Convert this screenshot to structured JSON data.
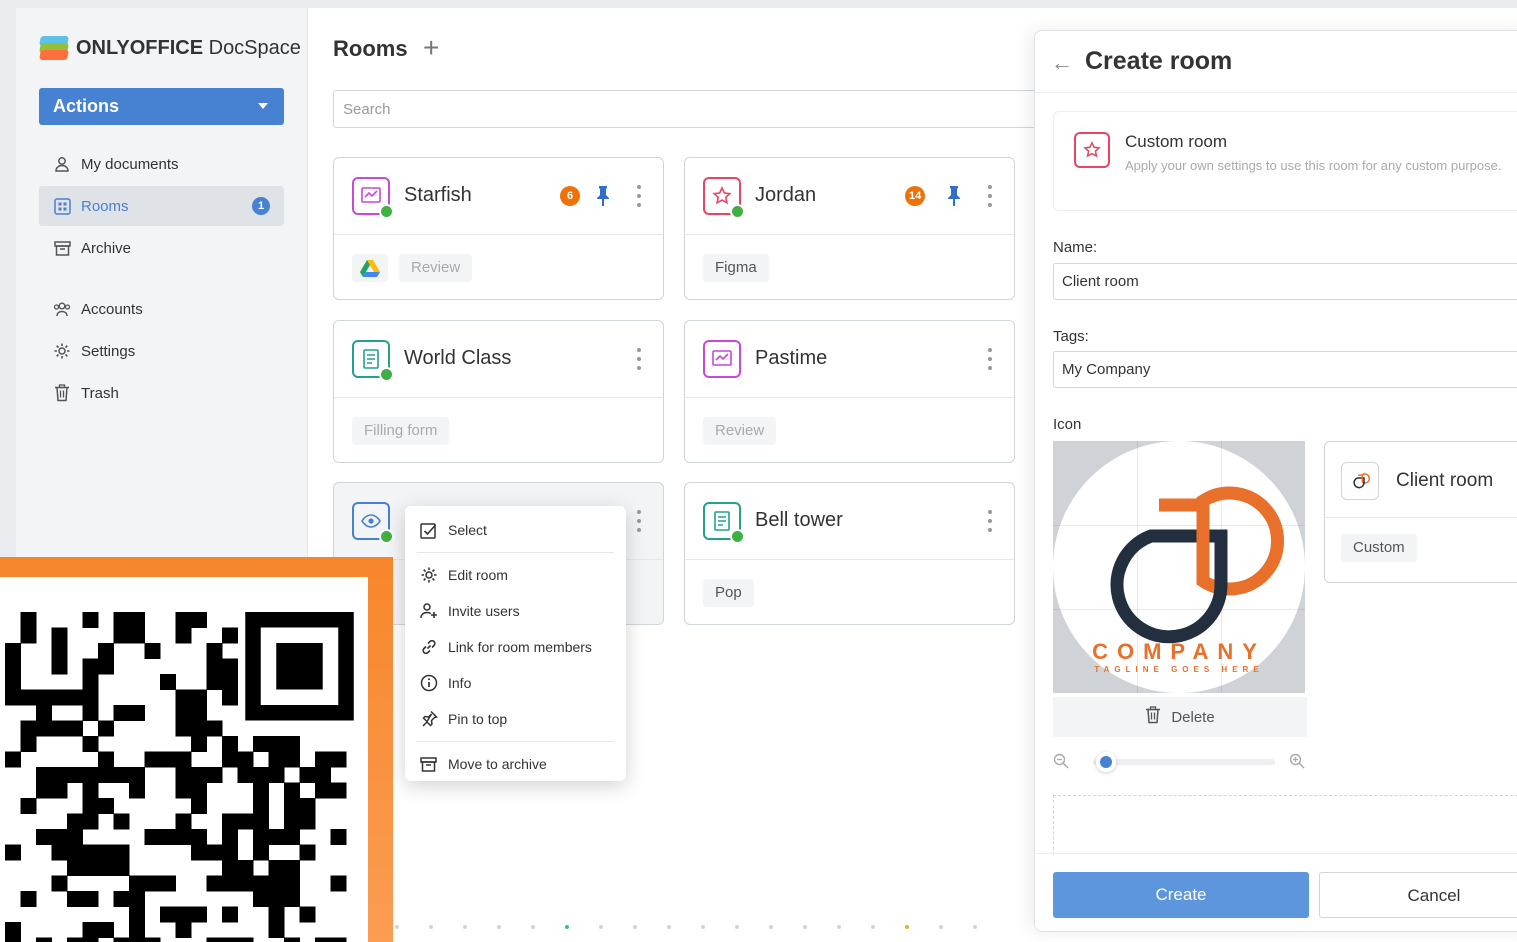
{
  "app": {
    "brand_bold": "ONLYOFFICE",
    "brand_light": " DocSpace"
  },
  "sidebar": {
    "actions_label": "Actions",
    "items": [
      {
        "label": "My documents",
        "icon": "user-icon"
      },
      {
        "label": "Rooms",
        "icon": "rooms-icon",
        "badge": "1",
        "active": true
      },
      {
        "label": "Archive",
        "icon": "archive-icon"
      },
      {
        "label": "Accounts",
        "icon": "accounts-icon"
      },
      {
        "label": "Settings",
        "icon": "gear-icon"
      },
      {
        "label": "Trash",
        "icon": "trash-icon"
      }
    ]
  },
  "main": {
    "title": "Rooms",
    "add_label": "+",
    "search_placeholder": "Search"
  },
  "rooms": [
    {
      "name": "Starfish",
      "tag": "Review",
      "count": "6",
      "pinned": true,
      "color": "#c649d8"
    },
    {
      "name": "Jordan",
      "tag": "Figma",
      "count": "14",
      "pinned": true,
      "color": "#e64564"
    },
    {
      "name": "World Class",
      "tag": "Filling form",
      "color": "#22a090"
    },
    {
      "name": "Pastime",
      "tag": "Review",
      "color": "#c649d8"
    },
    {
      "name": "",
      "tag": "",
      "color": "#4781d1"
    },
    {
      "name": "Bell tower",
      "tag": "Pop",
      "color": "#22a090"
    }
  ],
  "context_menu": {
    "items": [
      {
        "label": "Select",
        "icon": "select-icon"
      },
      {
        "label": "Edit room",
        "icon": "gear-icon"
      },
      {
        "label": "Invite users",
        "icon": "invite-user-icon"
      },
      {
        "label": "Link for room members",
        "icon": "link-icon"
      },
      {
        "label": "Info",
        "icon": "info-icon"
      },
      {
        "label": "Pin to top",
        "icon": "pin-icon"
      },
      {
        "label": "Move to archive",
        "icon": "archive-icon"
      }
    ]
  },
  "panel": {
    "title": "Create room",
    "type_name": "Custom room",
    "type_desc": "Apply your own settings to use this room for any custom purpose.",
    "name_label": "Name:",
    "name_value": "Client room",
    "tags_label": "Tags:",
    "tags_value": "My Company",
    "icon_label": "Icon",
    "logo_text": "COMPANY",
    "logo_tagline": "TAGLINE GOES HERE",
    "delete_label": "Delete",
    "zoom_level": 0.05,
    "preview_name": "Client room",
    "preview_tag": "Custom",
    "create_label": "Create",
    "cancel_label": "Cancel"
  },
  "colors": {
    "accent": "#4781d1",
    "orange": "#ed7309",
    "green": "#3fb042"
  }
}
